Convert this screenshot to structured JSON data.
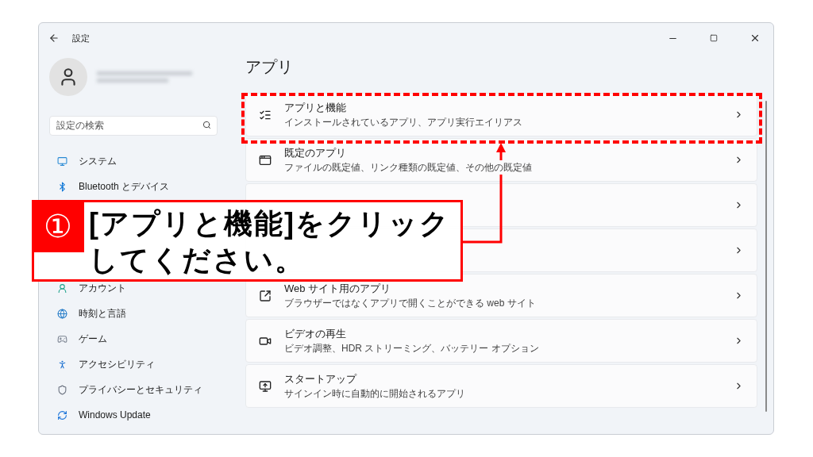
{
  "window": {
    "title": "設定"
  },
  "search": {
    "placeholder": "設定の検索"
  },
  "sidebar": {
    "items": [
      {
        "kind": "item",
        "label": "システム"
      },
      {
        "kind": "item",
        "label": "Bluetooth とデバイス"
      },
      {
        "kind": "covered"
      },
      {
        "kind": "covered"
      },
      {
        "kind": "covered"
      },
      {
        "kind": "item",
        "label": "アカウント"
      },
      {
        "kind": "item",
        "label": "時刻と言語"
      },
      {
        "kind": "item",
        "label": "ゲーム"
      },
      {
        "kind": "item",
        "label": "アクセシビリティ"
      },
      {
        "kind": "item",
        "label": "プライバシーとセキュリティ"
      },
      {
        "kind": "item",
        "label": "Windows Update"
      }
    ]
  },
  "page": {
    "title": "アプリ",
    "cards": [
      {
        "kind": "item",
        "title": "アプリと機能",
        "subtitle": "インストールされているアプリ、アプリ実行エイリアス"
      },
      {
        "kind": "item",
        "title": "既定のアプリ",
        "subtitle": "ファイルの既定値、リンク種類の既定値、その他の既定値"
      },
      {
        "kind": "covered"
      },
      {
        "kind": "covered"
      },
      {
        "kind": "item",
        "title": "Web サイト用のアプリ",
        "subtitle": "ブラウザーではなくアプリで開くことができる web サイト"
      },
      {
        "kind": "item",
        "title": "ビデオの再生",
        "subtitle": "ビデオ調整、HDR ストリーミング、バッテリー オプション"
      },
      {
        "kind": "item",
        "title": "スタートアップ",
        "subtitle": "サインイン時に自動的に開始されるアプリ"
      }
    ]
  },
  "callout": {
    "number": "①",
    "lines": [
      "[アプリと機能]をクリック",
      "してください。"
    ]
  }
}
